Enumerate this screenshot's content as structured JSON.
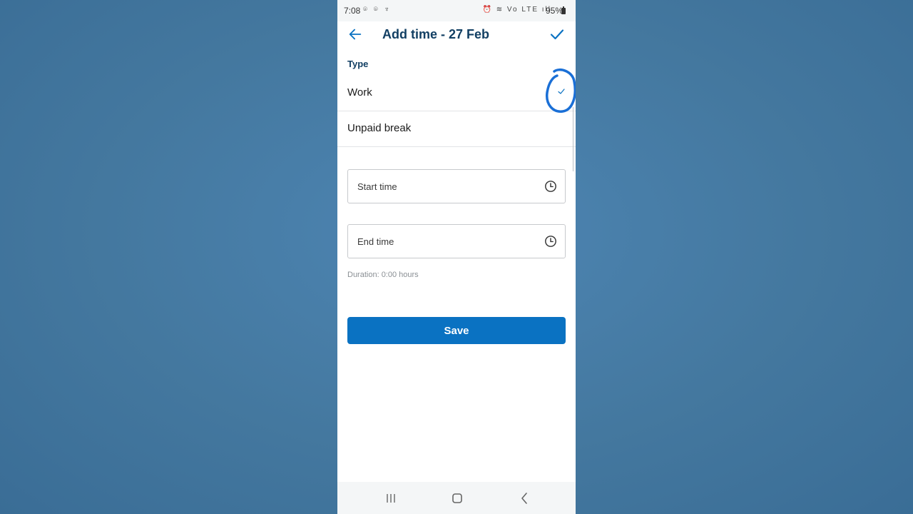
{
  "status_bar": {
    "time": "7:08",
    "left_icons": "⌾ ⌾ ♆",
    "right_icons": "⏰ ≋ Vo LTE ıll",
    "battery": "95%"
  },
  "header": {
    "title": "Add time - 27 Feb"
  },
  "type_section": {
    "label": "Type",
    "options": [
      {
        "label": "Work",
        "selected": true
      },
      {
        "label": "Unpaid break",
        "selected": false
      }
    ]
  },
  "fields": {
    "start_time_placeholder": "Start time",
    "end_time_placeholder": "End time"
  },
  "duration_text": "Duration: 0:00 hours",
  "save_label": "Save",
  "colors": {
    "accent": "#0a72c2",
    "title": "#123f63",
    "annotation": "#1a6fd6",
    "background": "#44789f"
  },
  "icons": {
    "back": "arrow-left-icon",
    "confirm": "checkmark-icon",
    "field_icon": "clock-icon",
    "nav": [
      "recents-icon",
      "home-icon",
      "back-icon"
    ]
  }
}
